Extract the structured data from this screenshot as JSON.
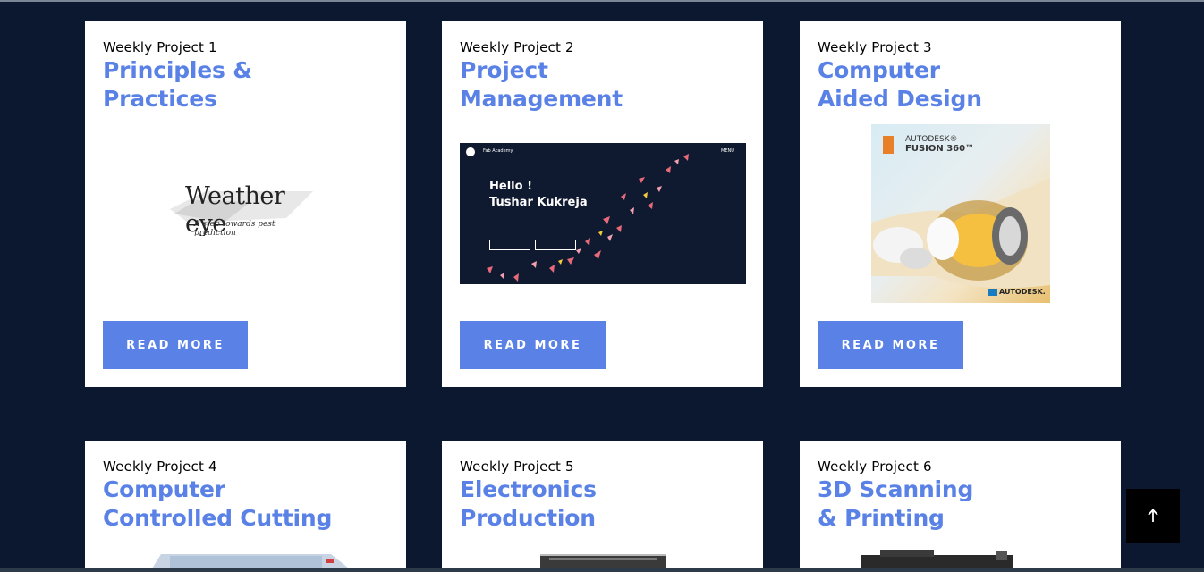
{
  "projects": [
    {
      "eyebrow": "Weekly Project 1",
      "title_line1": "Principles &",
      "title_line2": "Practices",
      "button": "READ MORE"
    },
    {
      "eyebrow": "Weekly Project 2",
      "title_line1": "Project",
      "title_line2": "Management",
      "button": "READ MORE"
    },
    {
      "eyebrow": "Weekly Project 3",
      "title_line1": "Computer",
      "title_line2": "Aided Design",
      "button": "READ MORE"
    },
    {
      "eyebrow": "Weekly Project 4",
      "title_line1": "Computer",
      "title_line2": "Controlled Cutting"
    },
    {
      "eyebrow": "Weekly Project 5",
      "title_line1": "Electronics",
      "title_line2": "Production"
    },
    {
      "eyebrow": "Weekly Project 6",
      "title_line1": "3D Scanning",
      "title_line2": "& Printing"
    }
  ],
  "thumbnails": {
    "weather_eye": {
      "title": "Weather eye",
      "subtitle": "A step towards pest prediction"
    },
    "fab_site": {
      "brand": "Fab Academy",
      "menu": "MENU",
      "greeting": "Hello !",
      "name": "Tushar Kukreja"
    },
    "fusion": {
      "brand_top": "AUTODESK®",
      "product": "FUSION 360™",
      "brand_bottom": "AUTODESK."
    }
  },
  "scroll_top_icon": "arrow-up-icon",
  "colors": {
    "background": "#0b1830",
    "accent": "#5a82e6",
    "card": "#ffffff"
  }
}
